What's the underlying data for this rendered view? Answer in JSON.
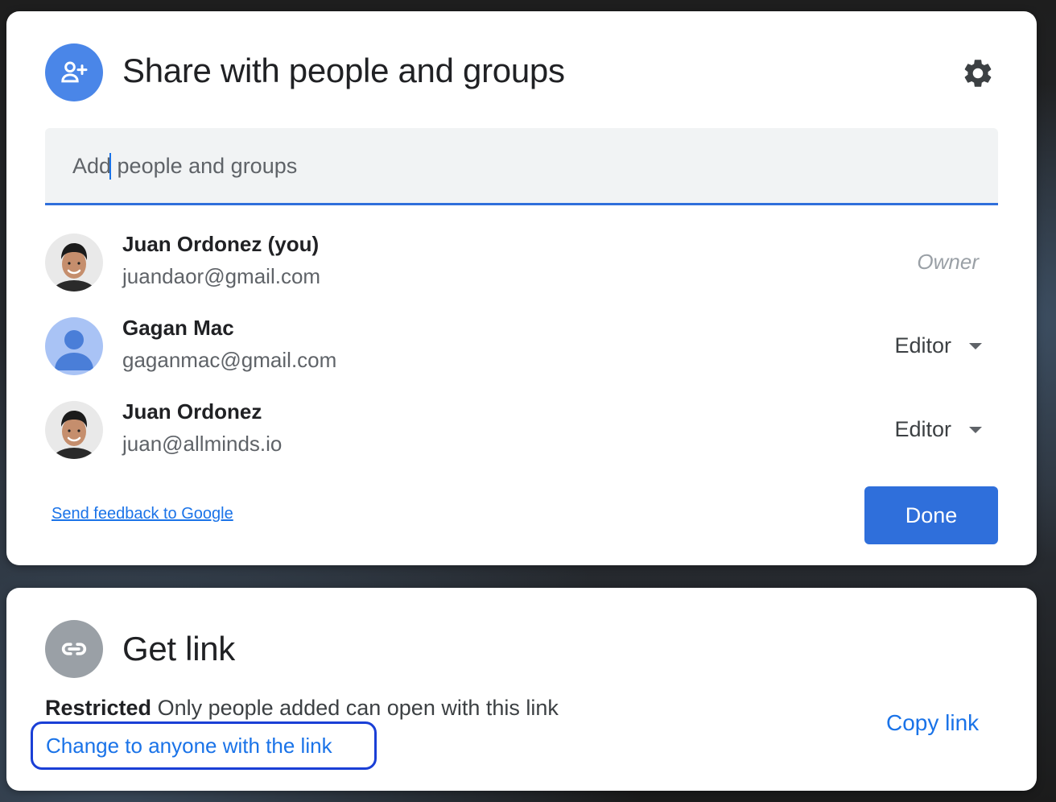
{
  "share": {
    "title": "Share with people and groups",
    "input_placeholder": "Add people and groups",
    "people": [
      {
        "name": "Juan Ordonez (you)",
        "email": "juandaor@gmail.com",
        "role": "Owner"
      },
      {
        "name": "Gagan Mac",
        "email": "gaganmac@gmail.com",
        "role": "Editor"
      },
      {
        "name": "Juan Ordonez",
        "email": "juan@allminds.io",
        "role": "Editor"
      }
    ],
    "feedback_label": "Send feedback to Google",
    "done_label": "Done"
  },
  "link": {
    "title": "Get link",
    "restricted_label": "Restricted",
    "restricted_desc": "Only people added can open with this link",
    "change_label": "Change to anyone with the link",
    "copy_label": "Copy link"
  },
  "colors": {
    "accent": "#2f6fdb",
    "link": "#1a73e8",
    "share_icon_bg": "#4a86e8",
    "link_icon_bg": "#9aa0a6",
    "default_avatar_bg": "#a9c3f5",
    "focus_ring": "#1a3fd6"
  },
  "icons": {
    "share_header": "person-add-icon",
    "settings": "gear-icon",
    "link_header": "link-icon",
    "role_dropdown": "caret-down-icon"
  }
}
